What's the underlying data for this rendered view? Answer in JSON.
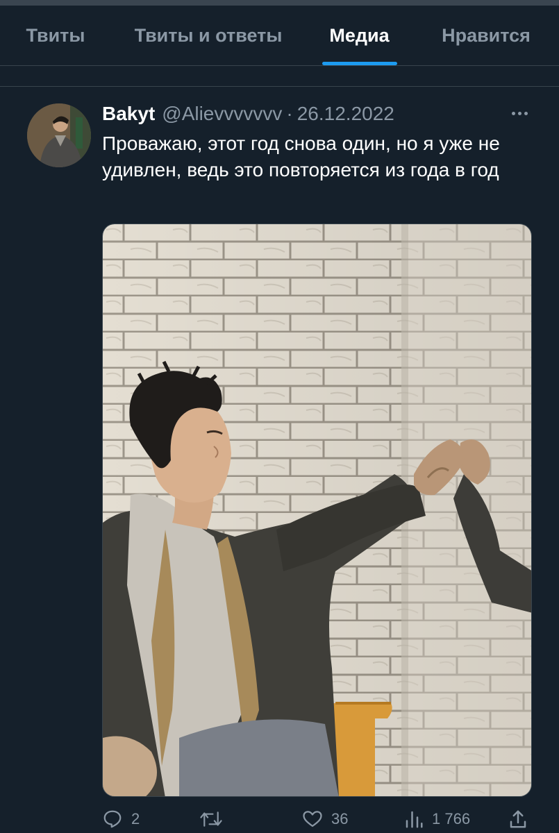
{
  "tabs": [
    {
      "label": "Твиты",
      "active": false
    },
    {
      "label": "Твиты и ответы",
      "active": false
    },
    {
      "label": "Медиа",
      "active": true
    },
    {
      "label": "Нравится",
      "active": false
    }
  ],
  "tweet": {
    "author_name": "Bakyt",
    "author_handle": "@Alievvvvvvv",
    "separator": "·",
    "date": "26.12.2022",
    "text": "Проважаю, этот год снова один, но я уже не удивлен, ведь это повторяется из года в год",
    "media_icon": "photo-image",
    "more_icon": "ellipsis-icon"
  },
  "actions": {
    "reply": {
      "icon": "reply-icon",
      "count": "2"
    },
    "retweet": {
      "icon": "retweet-icon",
      "count": ""
    },
    "like": {
      "icon": "heart-icon",
      "count": "36"
    },
    "views": {
      "icon": "views-icon",
      "count": "1 766"
    },
    "share": {
      "icon": "share-icon",
      "count": ""
    }
  },
  "colors": {
    "background": "#15202b",
    "accent": "#1d9bf0",
    "muted_text": "#8b98a5",
    "border": "#38444d"
  }
}
